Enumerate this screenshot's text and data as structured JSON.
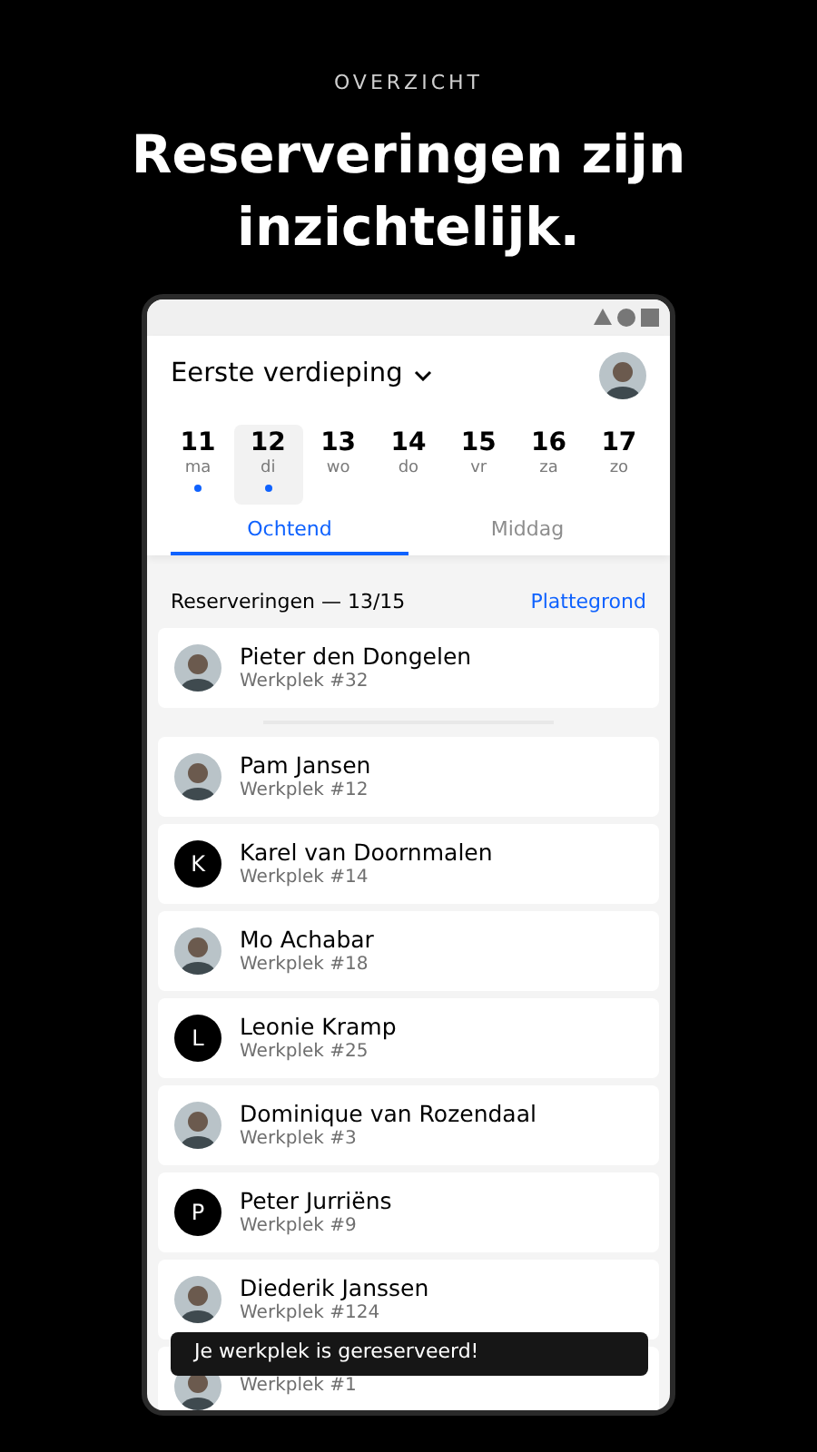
{
  "eyebrow": "OVERZICHT",
  "headline": "Reserveringen zijn inzichtelijk.",
  "app": {
    "floor": "Eerste verdieping",
    "days": [
      {
        "number": "11",
        "weekday": "ma",
        "has_booking": true,
        "selected": false
      },
      {
        "number": "12",
        "weekday": "di",
        "has_booking": true,
        "selected": true
      },
      {
        "number": "13",
        "weekday": "wo",
        "has_booking": false,
        "selected": false
      },
      {
        "number": "14",
        "weekday": "do",
        "has_booking": false,
        "selected": false
      },
      {
        "number": "15",
        "weekday": "vr",
        "has_booking": false,
        "selected": false
      },
      {
        "number": "16",
        "weekday": "za",
        "has_booking": false,
        "selected": false
      },
      {
        "number": "17",
        "weekday": "zo",
        "has_booking": false,
        "selected": false
      }
    ],
    "tabs": [
      {
        "label": "Ochtend",
        "selected": true
      },
      {
        "label": "Middag",
        "selected": false
      }
    ],
    "section_title": "Reserveringen — 13/15",
    "map_link": "Plattegrond",
    "own_reservation": {
      "name": "Pieter den Dongelen",
      "desk": "Werkplek #32",
      "avatar": {
        "kind": "photo"
      }
    },
    "reservations": [
      {
        "name": "Pam Jansen",
        "desk": "Werkplek #12",
        "avatar": {
          "kind": "photo"
        }
      },
      {
        "name": "Karel van Doornmalen",
        "desk": "Werkplek #14",
        "avatar": {
          "kind": "initial",
          "initial": "K"
        }
      },
      {
        "name": "Mo Achabar",
        "desk": "Werkplek #18",
        "avatar": {
          "kind": "photo"
        }
      },
      {
        "name": "Leonie Kramp",
        "desk": "Werkplek #25",
        "avatar": {
          "kind": "initial",
          "initial": "L"
        }
      },
      {
        "name": "Dominique van Rozendaal",
        "desk": "Werkplek #3",
        "avatar": {
          "kind": "photo"
        }
      },
      {
        "name": "Peter Jurriëns",
        "desk": "Werkplek #9",
        "avatar": {
          "kind": "initial",
          "initial": "P"
        }
      },
      {
        "name": "Diederik Janssen",
        "desk": "Werkplek #124",
        "avatar": {
          "kind": "photo"
        }
      },
      {
        "desk": "Werkplek #1",
        "avatar": {
          "kind": "photo"
        }
      }
    ],
    "toast": "Je werkplek is gereserveerd!"
  }
}
